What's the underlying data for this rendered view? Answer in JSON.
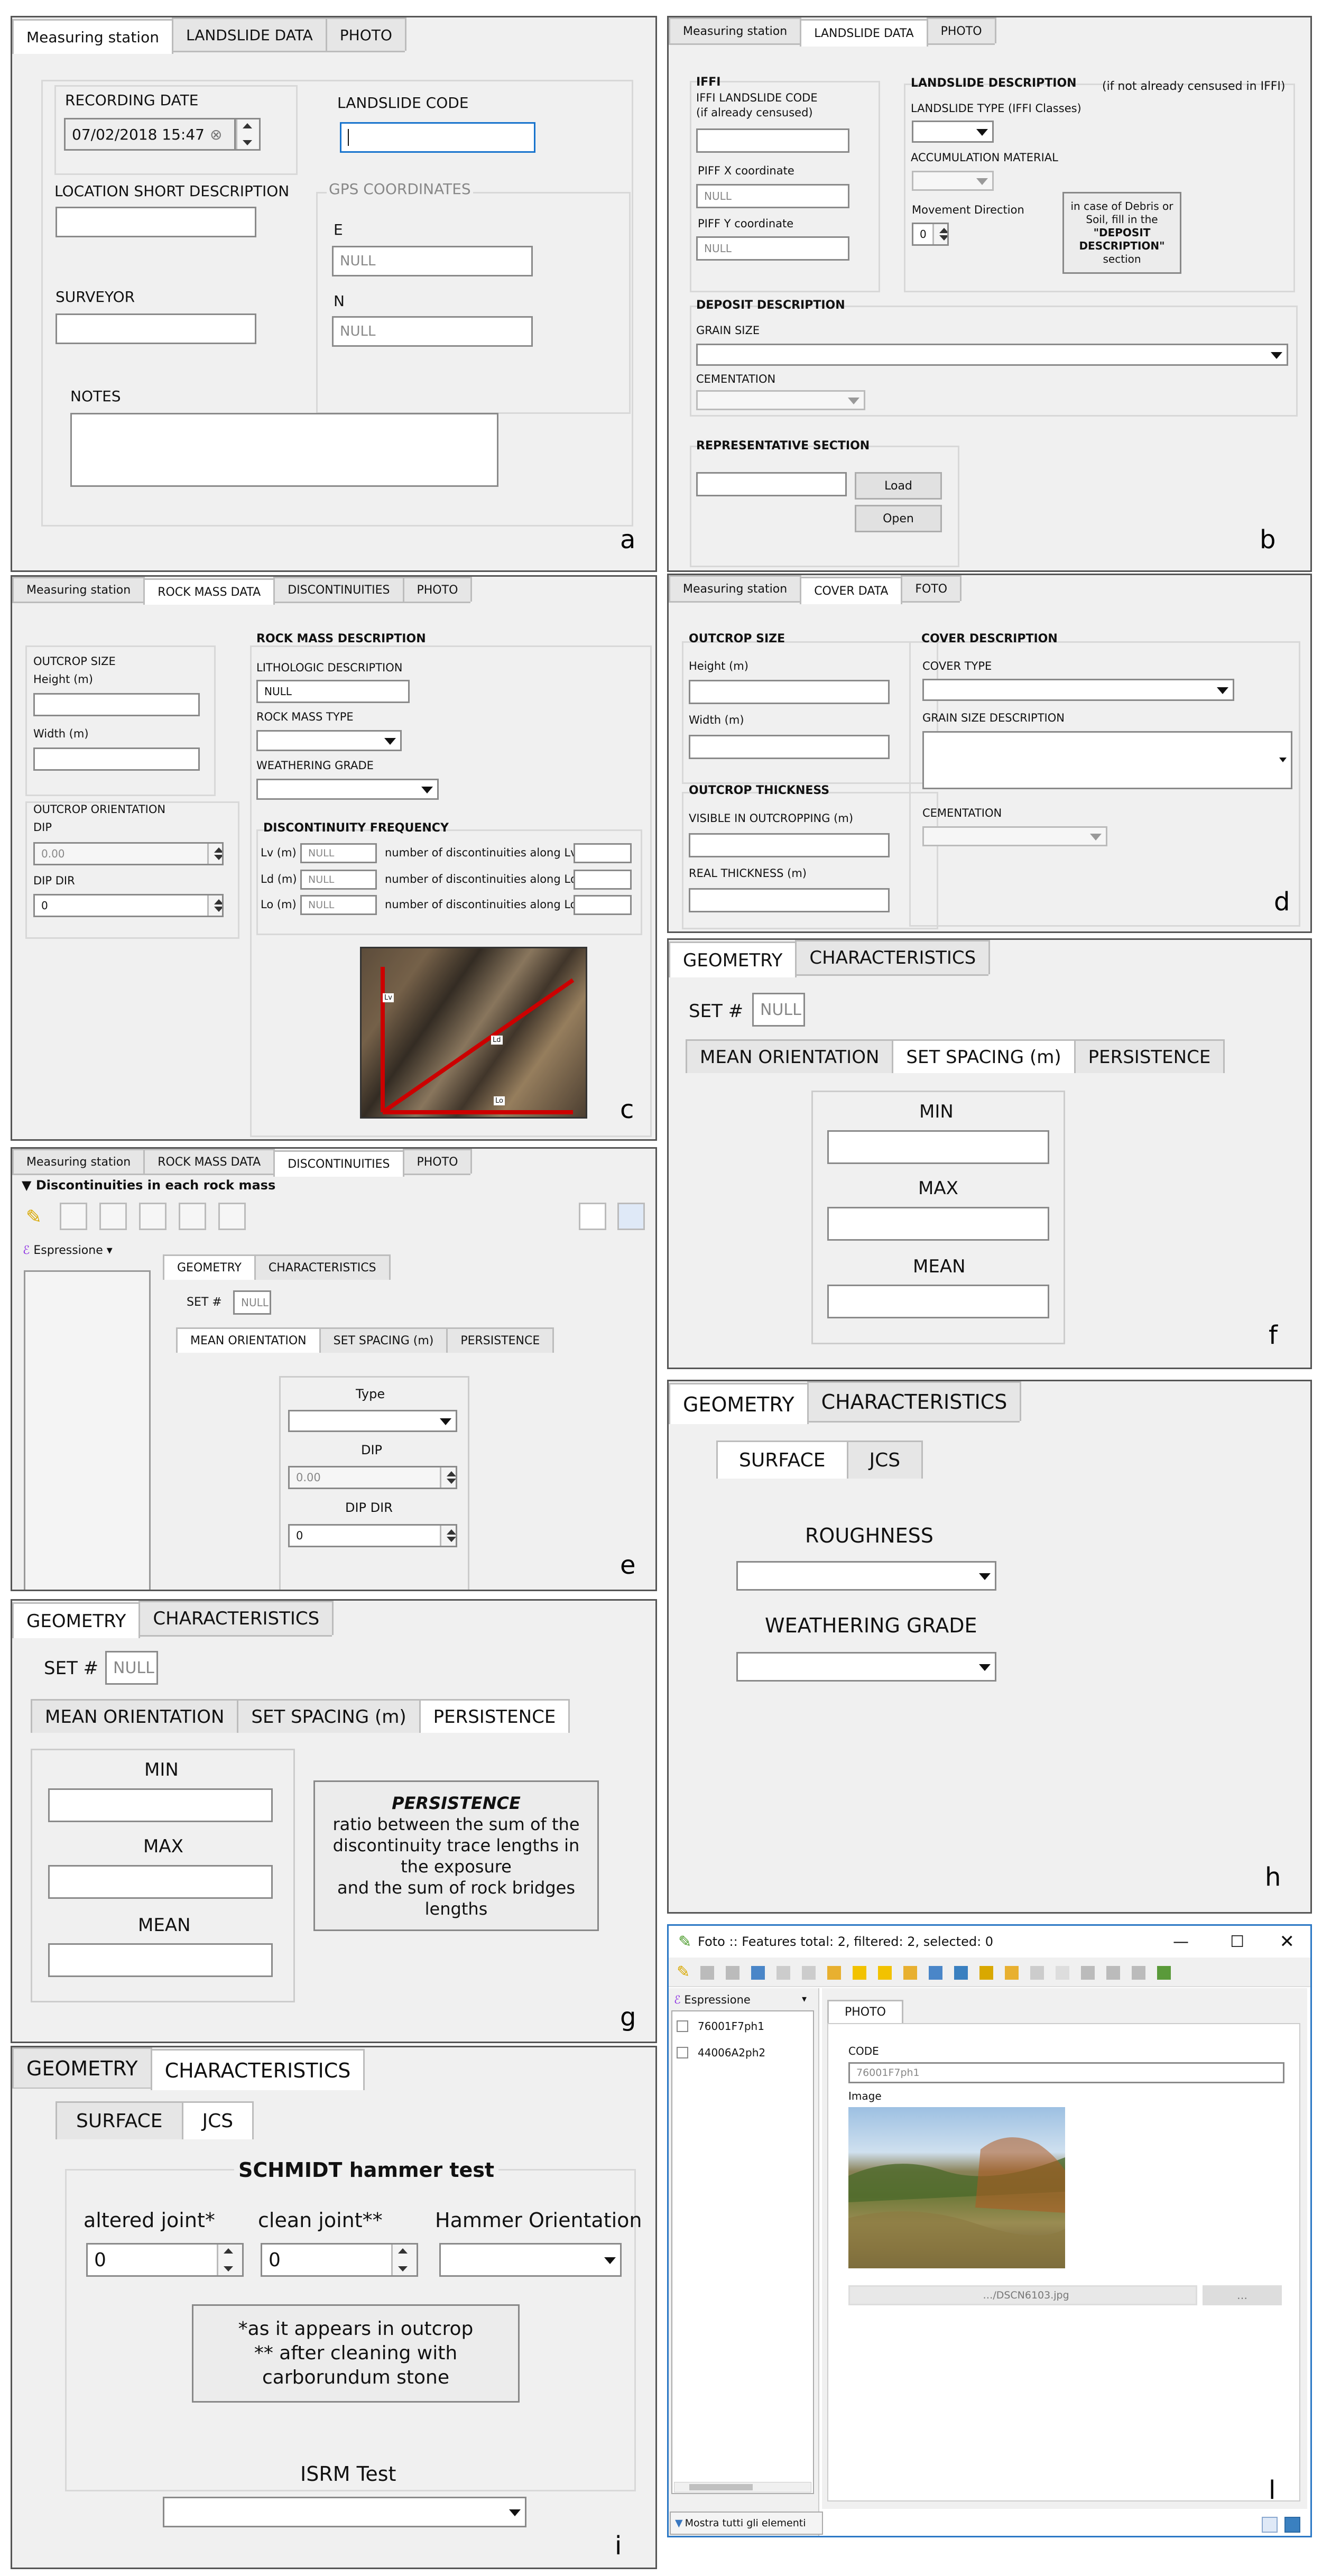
{
  "panel_a": {
    "tabs": [
      "Measuring station",
      "LANDSLIDE DATA",
      "PHOTO"
    ],
    "recording_date_label": "RECORDING DATE",
    "recording_date_value": "07/02/2018 15:47",
    "landslide_code_label": "LANDSLIDE CODE",
    "location_label": "LOCATION SHORT DESCRIPTION",
    "gps_label": "GPS COORDINATES",
    "e_label": "E",
    "e_value": "NULL",
    "n_label": "N",
    "n_value": "NULL",
    "surveyor_label": "SURVEYOR",
    "notes_label": "NOTES",
    "letter": "a"
  },
  "panel_b": {
    "tabs": [
      "Measuring station",
      "LANDSLIDE DATA",
      "PHOTO"
    ],
    "iffi_label": "IFFI",
    "iffi_code_label": "IFFI LANDSLIDE CODE",
    "iffi_code_sub": "(if already censused)",
    "piff_x_label": "PIFF X coordinate",
    "piff_x_value": "NULL",
    "piff_y_label": "PIFF Y coordinate",
    "piff_y_value": "NULL",
    "landslide_desc_label": "LANDSLIDE DESCRIPTION",
    "landslide_desc_note": "(if not already censused in IFFI)",
    "landslide_type_label": "LANDSLIDE TYPE (IFFI Classes)",
    "accumulation_label": "ACCUMULATION MATERIAL",
    "movement_label": "Movement Direction",
    "movement_value": "0",
    "debris_note_1": "in case of Debris or",
    "debris_note_2": "Soil, fill in the",
    "debris_note_3": "\"DEPOSIT",
    "debris_note_4": "DESCRIPTION\"",
    "debris_note_5": "section",
    "deposit_label": "DEPOSIT DESCRIPTION",
    "grain_label": "GRAIN SIZE",
    "cementation_label": "CEMENTATION",
    "rep_section_label": "REPRESENTATIVE SECTION",
    "load_button": "Load",
    "open_button": "Open",
    "letter": "b"
  },
  "panel_c": {
    "tabs": [
      "Measuring station",
      "ROCK MASS DATA",
      "DISCONTINUITIES",
      "PHOTO"
    ],
    "outcrop_size_label": "OUTCROP SIZE",
    "height_label": "Height (m)",
    "width_label": "Width (m)",
    "outcrop_orient_label": "OUTCROP ORIENTATION",
    "dip_label": "DIP",
    "dip_value": "0.00",
    "dipdir_label": "DIP DIR",
    "dipdir_value": "0",
    "rock_desc_label": "ROCK MASS DESCRIPTION",
    "litho_label": "LITHOLOGIC DESCRIPTION",
    "litho_value": "NULL",
    "rock_type_label": "ROCK MASS TYPE",
    "weathering_label": "WEATHERING GRADE",
    "disc_freq_label": "DISCONTINUITY FREQUENCY",
    "lv_label": "Lv (m)",
    "ld_label": "Ld (m)",
    "lo_label": "Lo (m)",
    "null_value": "NULL",
    "lv_desc": "number of discontinuities along Lv",
    "ld_desc": "number of discontinuities along Ld",
    "lo_desc": "number of discontinuities along Lo",
    "photo_tags": [
      "Lv",
      "Ld",
      "Lo"
    ],
    "letter": "c"
  },
  "panel_d": {
    "tabs": [
      "Measuring station",
      "COVER DATA",
      "FOTO"
    ],
    "outcrop_size_label": "OUTCROP SIZE",
    "height_label": "Height (m)",
    "width_label": "Width (m)",
    "thickness_label": "OUTCROP THICKNESS",
    "visible_label": "VISIBLE IN OUTCROPPING (m)",
    "real_label": "REAL THICKNESS (m)",
    "cover_desc_label": "COVER DESCRIPTION",
    "cover_type_label": "COVER TYPE",
    "grain_desc_label": "GRAIN SIZE DESCRIPTION",
    "cementation_label": "CEMENTATION",
    "letter": "d"
  },
  "panel_e": {
    "tabs": [
      "Measuring station",
      "ROCK MASS DATA",
      "DISCONTINUITIES",
      "PHOTO"
    ],
    "section_title": "Discontinuities in each rock mass",
    "expr_label": "Espressione",
    "inner_tabs": [
      "GEOMETRY",
      "CHARACTERISTICS"
    ],
    "set_label": "SET #",
    "set_value": "NULL",
    "sub_tabs": [
      "MEAN ORIENTATION",
      "SET SPACING (m)",
      "PERSISTENCE"
    ],
    "type_label": "Type",
    "dip_label": "DIP",
    "dip_value": "0.00",
    "dipdir_label": "DIP DIR",
    "dipdir_value": "0",
    "letter": "e"
  },
  "panel_f": {
    "tabs": [
      "GEOMETRY",
      "CHARACTERISTICS"
    ],
    "set_label": "SET #",
    "set_value": "NULL",
    "sub_tabs": [
      "MEAN ORIENTATION",
      "SET SPACING (m)",
      "PERSISTENCE"
    ],
    "min_label": "MIN",
    "max_label": "MAX",
    "mean_label": "MEAN",
    "letter": "f"
  },
  "panel_g": {
    "tabs": [
      "GEOMETRY",
      "CHARACTERISTICS"
    ],
    "set_label": "SET #",
    "set_value": "NULL",
    "sub_tabs": [
      "MEAN ORIENTATION",
      "SET SPACING (m)",
      "PERSISTENCE"
    ],
    "min_label": "MIN",
    "max_label": "MAX",
    "mean_label": "MEAN",
    "info_title": "PERSISTENCE",
    "info_lines": [
      "ratio between the sum of the",
      "discontinuity trace lengths in",
      "the exposure",
      "and the sum of rock bridges",
      "lengths"
    ],
    "letter": "g"
  },
  "panel_h": {
    "tabs": [
      "GEOMETRY",
      "CHARACTERISTICS"
    ],
    "sub_tabs": [
      "SURFACE",
      "JCS"
    ],
    "roughness_label": "ROUGHNESS",
    "weathering_label": "WEATHERING GRADE",
    "letter": "h"
  },
  "panel_i": {
    "tabs": [
      "GEOMETRY",
      "CHARACTERISTICS"
    ],
    "sub_tabs": [
      "SURFACE",
      "JCS"
    ],
    "schmidt_label": "SCHMIDT hammer test",
    "altered_label": "altered joint*",
    "altered_value": "0",
    "clean_label": "clean joint**",
    "clean_value": "0",
    "hammer_label": "Hammer Orientation",
    "note_lines": [
      "*as it appears in outcrop",
      "** after cleaning with",
      "carborundum stone"
    ],
    "isrm_label": "ISRM Test",
    "letter": "i"
  },
  "panel_l": {
    "window_title": "Foto :: Features total: 2, filtered: 2, selected: 0",
    "expr_label": "Espressione",
    "features": [
      "76001F7ph1",
      "44006A2ph2"
    ],
    "tab": "PHOTO",
    "code_label": "CODE",
    "code_value": "76001F7ph1",
    "image_label": "Image",
    "file_value": "…/DSCN6103.jpg",
    "browse_label": "…",
    "show_all": "Mostra tutti gli elementi",
    "letter": "l"
  }
}
